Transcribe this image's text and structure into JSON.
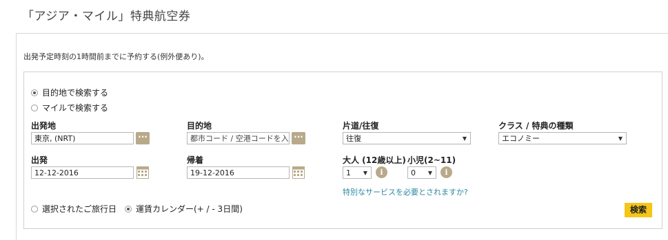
{
  "page_title": "「アジア・マイル」特典航空券",
  "note": "出発予定時刻の1時間前までに予約する(例外便あり)。",
  "search_mode": {
    "option_destination": "目的地で検索する",
    "option_miles": "マイルで検索する",
    "selected": "destination"
  },
  "fields": {
    "origin_label": "出発地",
    "origin_value": "東京, (NRT)",
    "destination_label": "目的地",
    "destination_placeholder": "都市コード / 空港コードを入力",
    "trip_label": "片道/往復",
    "trip_value": "往復",
    "class_label": "クラス / 特典の種類",
    "class_value": "エコノミー",
    "depart_label": "出発",
    "depart_value": "12-12-2016",
    "return_label": "帰着",
    "return_value": "19-12-2016",
    "adults_label": "大人 (12歳以上)",
    "adults_value": "1",
    "children_label": "小児(2~11)",
    "children_value": "0"
  },
  "special_service_link": "特別なサービスを必要とされますか?",
  "date_mode": {
    "option_selected_date": "選択されたご旅行日",
    "option_calendar": "運賃カレンダー(+ / - 3日間)",
    "selected": "calendar"
  },
  "search_button": "検索",
  "colors": {
    "accent_button": "#f5c518",
    "icon_tan": "#b8a98a",
    "link": "#2a8aa3"
  }
}
